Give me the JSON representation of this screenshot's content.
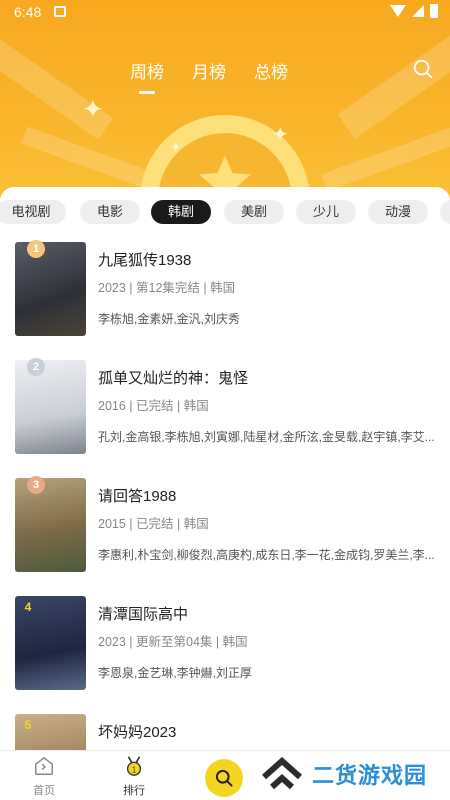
{
  "status_bar": {
    "time": "6:48"
  },
  "top_tabs": [
    {
      "label": "周榜",
      "active": true
    },
    {
      "label": "月榜",
      "active": false
    },
    {
      "label": "总榜",
      "active": false
    }
  ],
  "categories": [
    {
      "label": "电视剧",
      "active": false
    },
    {
      "label": "电影",
      "active": false
    },
    {
      "label": "韩剧",
      "active": true
    },
    {
      "label": "美剧",
      "active": false
    },
    {
      "label": "少儿",
      "active": false
    },
    {
      "label": "动漫",
      "active": false
    }
  ],
  "items": [
    {
      "rank": "1",
      "title": "九尾狐传1938",
      "meta": "2023 | 第12集完结 | 韩国",
      "cast": "李栋旭,金素妍,金汎,刘庆秀",
      "poster_color": "#3d3f4a"
    },
    {
      "rank": "2",
      "title": "孤单又灿烂的神：鬼怪",
      "meta": "2016 | 已完结 | 韩国",
      "cast": "孔刘,金高银,李栋旭,刘寅娜,陆星材,金所泫,金旻载,赵宇镇,李艾...",
      "poster_color": "#d9dde2"
    },
    {
      "rank": "3",
      "title": "请回答1988",
      "meta": "2015 | 已完结 | 韩国",
      "cast": "李惠利,朴宝剑,柳俊烈,高庚杓,成东日,李一花,金成钧,罗美兰,李...",
      "poster_color": "#8a7a56"
    },
    {
      "rank": "4",
      "title": "清潭国际高中",
      "meta": "2023 | 更新至第04集 | 韩国",
      "cast": "李恩泉,金艺琳,李钟爀,刘正厚",
      "poster_color": "#26314f"
    },
    {
      "rank": "5",
      "title": "坏妈妈2023",
      "meta": "",
      "cast": "",
      "poster_color": "#9b7d5a"
    }
  ],
  "bottom_nav": {
    "home_label": "首页",
    "rank_label": "排行",
    "brand_text": "二货游戏园"
  },
  "colors": {
    "accent": "#f7a81f",
    "fab": "#f5d61f",
    "brand": "#2a8fd6"
  }
}
